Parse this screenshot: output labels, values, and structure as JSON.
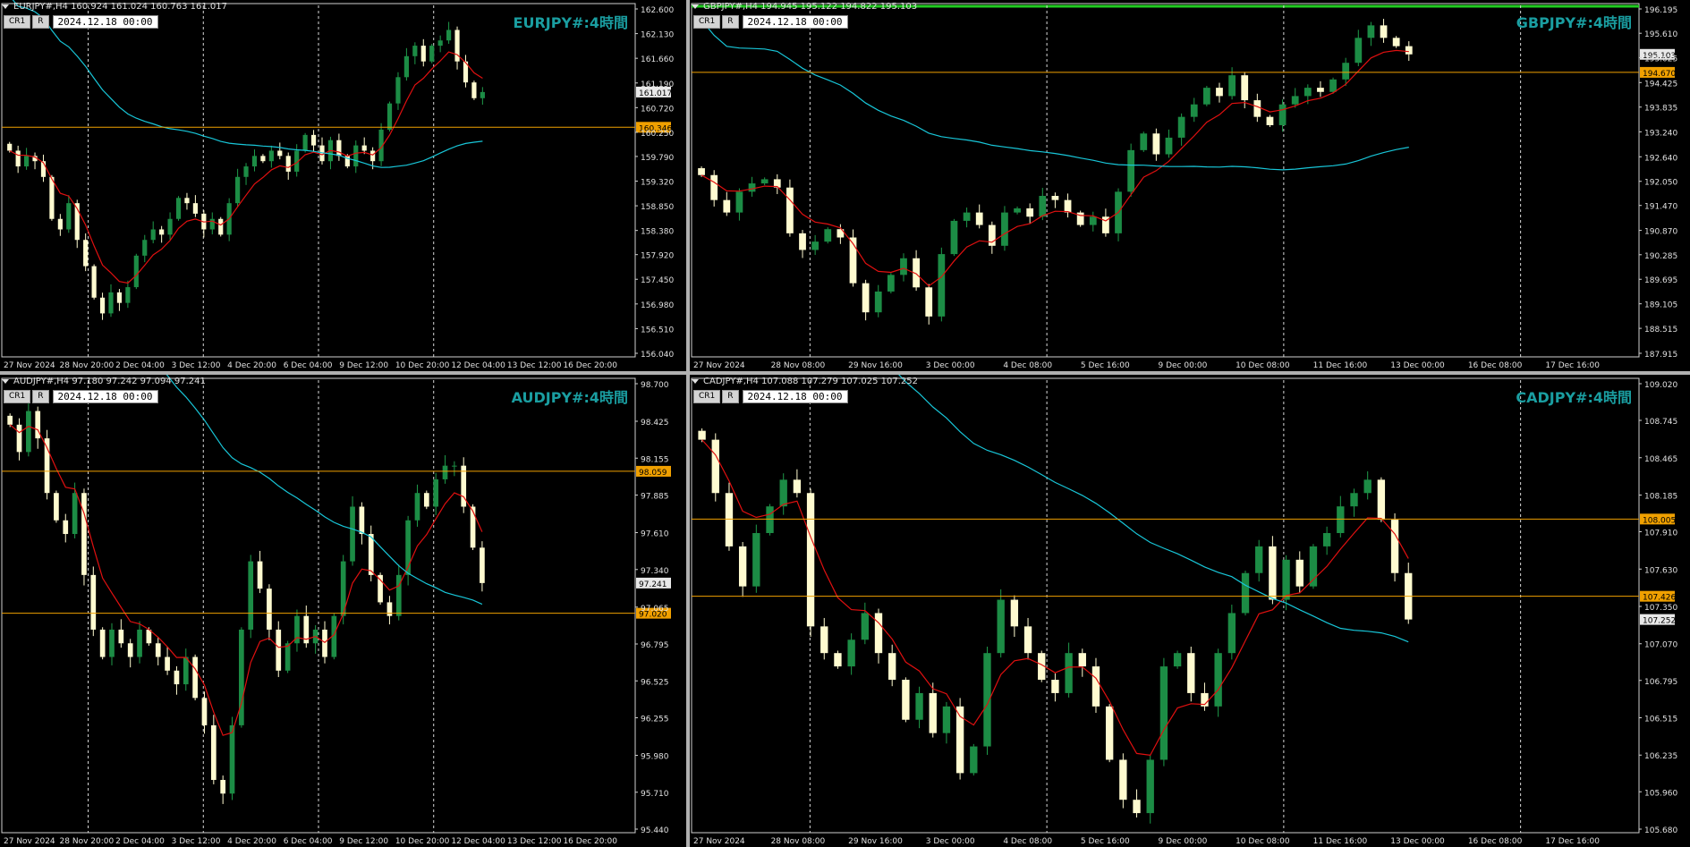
{
  "panels": [
    {
      "id": "eurjpy",
      "symbol_header": "EURJPY#,H4  160.924 161.024 160.763 161.017",
      "title": "EURJPY#:4時間",
      "date": "2024.12.18 00:00",
      "cr_label": "CR1",
      "r_label": "R",
      "price_labels": [
        "162.600",
        "162.130",
        "161.660",
        "161.190",
        "160.720",
        "160.250",
        "159.790",
        "159.320",
        "158.850",
        "158.380",
        "157.920",
        "157.450",
        "156.980",
        "156.510",
        "156.040"
      ],
      "time_labels": [
        "27 Nov 2024",
        "28 Nov 20:00",
        "2 Dec 04:00",
        "3 Dec 12:00",
        "4 Dec 20:00",
        "6 Dec 04:00",
        "9 Dec 12:00",
        "10 Dec 20:00",
        "12 Dec 04:00",
        "13 Dec 12:00",
        "16 Dec 20:00"
      ],
      "level_tags": [
        "160.346"
      ],
      "level_values": [
        160.346
      ],
      "current_price": "161.017",
      "current_value": 161.017,
      "ylim": [
        156.04,
        162.6
      ],
      "ma_fast_color": "#e01010",
      "ma_slow_color": "#18c6d8",
      "level_color": "#f0a000",
      "has_top_green": false
    },
    {
      "id": "gbpjpy",
      "symbol_header": "GBPJPY#,H4  194.945 195.122 194.822 195.103",
      "title": "GBPJPY#:4時間",
      "date": "2024.12.18 00:00",
      "cr_label": "CR1",
      "r_label": "R",
      "price_labels": [
        "196.195",
        "195.610",
        "195.025",
        "194.425",
        "193.835",
        "193.240",
        "192.640",
        "192.050",
        "191.470",
        "190.870",
        "190.285",
        "189.695",
        "189.105",
        "188.515",
        "187.915"
      ],
      "time_labels": [
        "27 Nov 2024",
        "28 Nov 08:00",
        "29 Nov 16:00",
        "3 Dec 00:00",
        "4 Dec 08:00",
        "5 Dec 16:00",
        "9 Dec 00:00",
        "10 Dec 08:00",
        "11 Dec 16:00",
        "13 Dec 00:00",
        "16 Dec 08:00",
        "17 Dec 16:00"
      ],
      "level_tags": [
        "194.670"
      ],
      "level_values": [
        194.67
      ],
      "current_price": "195.103",
      "current_value": 195.103,
      "ylim": [
        187.915,
        196.195
      ],
      "ma_fast_color": "#e01010",
      "ma_slow_color": "#18c6d8",
      "level_color": "#f0a000",
      "has_top_green": true
    },
    {
      "id": "audjpy",
      "symbol_header": "AUDJPY#,H4  97.180 97.242 97.094 97.241",
      "title": "AUDJPY#:4時間",
      "date": "2024.12.18 00:00",
      "cr_label": "CR1",
      "r_label": "R",
      "price_labels": [
        "98.700",
        "98.425",
        "98.155",
        "97.885",
        "97.610",
        "97.340",
        "97.065",
        "96.795",
        "96.525",
        "96.255",
        "95.980",
        "95.710",
        "95.440"
      ],
      "time_labels": [
        "27 Nov 2024",
        "28 Nov 20:00",
        "2 Dec 04:00",
        "3 Dec 12:00",
        "4 Dec 20:00",
        "6 Dec 04:00",
        "9 Dec 12:00",
        "10 Dec 20:00",
        "12 Dec 04:00",
        "13 Dec 12:00",
        "16 Dec 20:00"
      ],
      "level_tags": [
        "98.059",
        "97.020"
      ],
      "level_values": [
        98.059,
        97.02
      ],
      "current_price": "97.241",
      "current_value": 97.241,
      "ylim": [
        95.44,
        98.7
      ],
      "ma_fast_color": "#e01010",
      "ma_slow_color": "#18c6d8",
      "level_color": "#f0a000",
      "has_top_green": false
    },
    {
      "id": "cadjpy",
      "symbol_header": "CADJPY#,H4  107.088 107.279 107.025 107.252",
      "title": "CADJPY#:4時間",
      "date": "2024.12.18 00:00",
      "cr_label": "CR1",
      "r_label": "R",
      "price_labels": [
        "109.020",
        "108.745",
        "108.465",
        "108.185",
        "107.910",
        "107.630",
        "107.350",
        "107.070",
        "106.795",
        "106.515",
        "106.235",
        "105.960",
        "105.680"
      ],
      "time_labels": [
        "27 Nov 2024",
        "28 Nov 08:00",
        "29 Nov 16:00",
        "3 Dec 00:00",
        "4 Dec 08:00",
        "5 Dec 16:00",
        "9 Dec 00:00",
        "10 Dec 08:00",
        "11 Dec 16:00",
        "13 Dec 00:00",
        "16 Dec 08:00",
        "17 Dec 16:00"
      ],
      "level_tags": [
        "108.005",
        "107.426"
      ],
      "level_values": [
        108.005,
        107.426
      ],
      "current_price": "107.252",
      "current_value": 107.252,
      "ylim": [
        105.68,
        109.02
      ],
      "ma_fast_color": "#e01010",
      "ma_slow_color": "#18c6d8",
      "level_color": "#f0a000",
      "has_top_green": false
    }
  ],
  "chart_data": [
    {
      "type": "candlestick",
      "title": "EURJPY#:4時間",
      "ylim": [
        156.04,
        162.6
      ],
      "close": [
        159.9,
        159.6,
        159.8,
        159.7,
        159.4,
        158.6,
        158.4,
        158.9,
        158.2,
        157.7,
        157.1,
        156.8,
        157.2,
        157.0,
        157.3,
        157.9,
        158.2,
        158.4,
        158.3,
        158.6,
        159.0,
        158.9,
        158.7,
        158.4,
        158.6,
        158.3,
        158.9,
        159.4,
        159.6,
        159.8,
        159.7,
        159.9,
        159.8,
        159.5,
        159.9,
        160.2,
        160.0,
        159.7,
        160.1,
        159.8,
        159.6,
        160.0,
        159.9,
        159.7,
        160.3,
        160.8,
        161.3,
        161.7,
        161.9,
        161.6,
        161.9,
        162.0,
        162.2,
        161.6,
        161.2,
        160.9,
        161.017
      ]
    },
    {
      "type": "candlestick",
      "title": "GBPJPY#:4時間",
      "ylim": [
        187.915,
        196.195
      ],
      "close": [
        192.2,
        191.6,
        191.3,
        191.8,
        192.0,
        192.1,
        191.9,
        190.8,
        190.4,
        190.6,
        190.9,
        190.7,
        189.6,
        188.9,
        189.4,
        189.8,
        190.2,
        189.5,
        188.8,
        190.3,
        191.1,
        191.3,
        191.0,
        190.5,
        191.3,
        191.4,
        191.2,
        191.7,
        191.6,
        191.3,
        191.0,
        191.2,
        190.8,
        191.8,
        192.8,
        193.2,
        192.7,
        193.1,
        193.6,
        193.9,
        194.3,
        194.1,
        194.6,
        194.0,
        193.6,
        193.4,
        193.9,
        194.1,
        194.3,
        194.2,
        194.5,
        194.9,
        195.5,
        195.8,
        195.5,
        195.3,
        195.103
      ]
    },
    {
      "type": "candlestick",
      "title": "AUDJPY#:4時間",
      "ylim": [
        95.44,
        98.7
      ],
      "close": [
        98.4,
        98.2,
        98.5,
        98.3,
        97.9,
        97.7,
        97.6,
        97.9,
        97.3,
        96.9,
        96.7,
        96.9,
        96.8,
        96.7,
        96.9,
        96.8,
        96.7,
        96.6,
        96.5,
        96.7,
        96.4,
        96.2,
        95.8,
        95.7,
        96.2,
        96.9,
        97.4,
        97.2,
        96.9,
        96.6,
        96.8,
        97.0,
        96.8,
        96.9,
        96.7,
        97.0,
        97.4,
        97.8,
        97.6,
        97.3,
        97.1,
        97.0,
        97.3,
        97.7,
        97.9,
        97.8,
        98.0,
        98.1,
        98.1,
        97.8,
        97.5,
        97.241
      ]
    },
    {
      "type": "candlestick",
      "title": "CADJPY#:4時間",
      "ylim": [
        105.68,
        109.02
      ],
      "close": [
        108.6,
        108.2,
        107.8,
        107.5,
        107.9,
        108.1,
        108.3,
        108.2,
        107.2,
        107.0,
        106.9,
        107.1,
        107.3,
        107.0,
        106.8,
        106.5,
        106.7,
        106.4,
        106.6,
        106.1,
        106.3,
        107.0,
        107.4,
        107.2,
        107.0,
        106.8,
        106.7,
        107.0,
        106.9,
        106.6,
        106.2,
        105.9,
        105.8,
        106.2,
        106.9,
        107.0,
        106.7,
        106.6,
        107.0,
        107.3,
        107.6,
        107.8,
        107.4,
        107.7,
        107.5,
        107.8,
        107.9,
        108.1,
        108.2,
        108.3,
        108.0,
        107.6,
        107.252
      ]
    }
  ]
}
